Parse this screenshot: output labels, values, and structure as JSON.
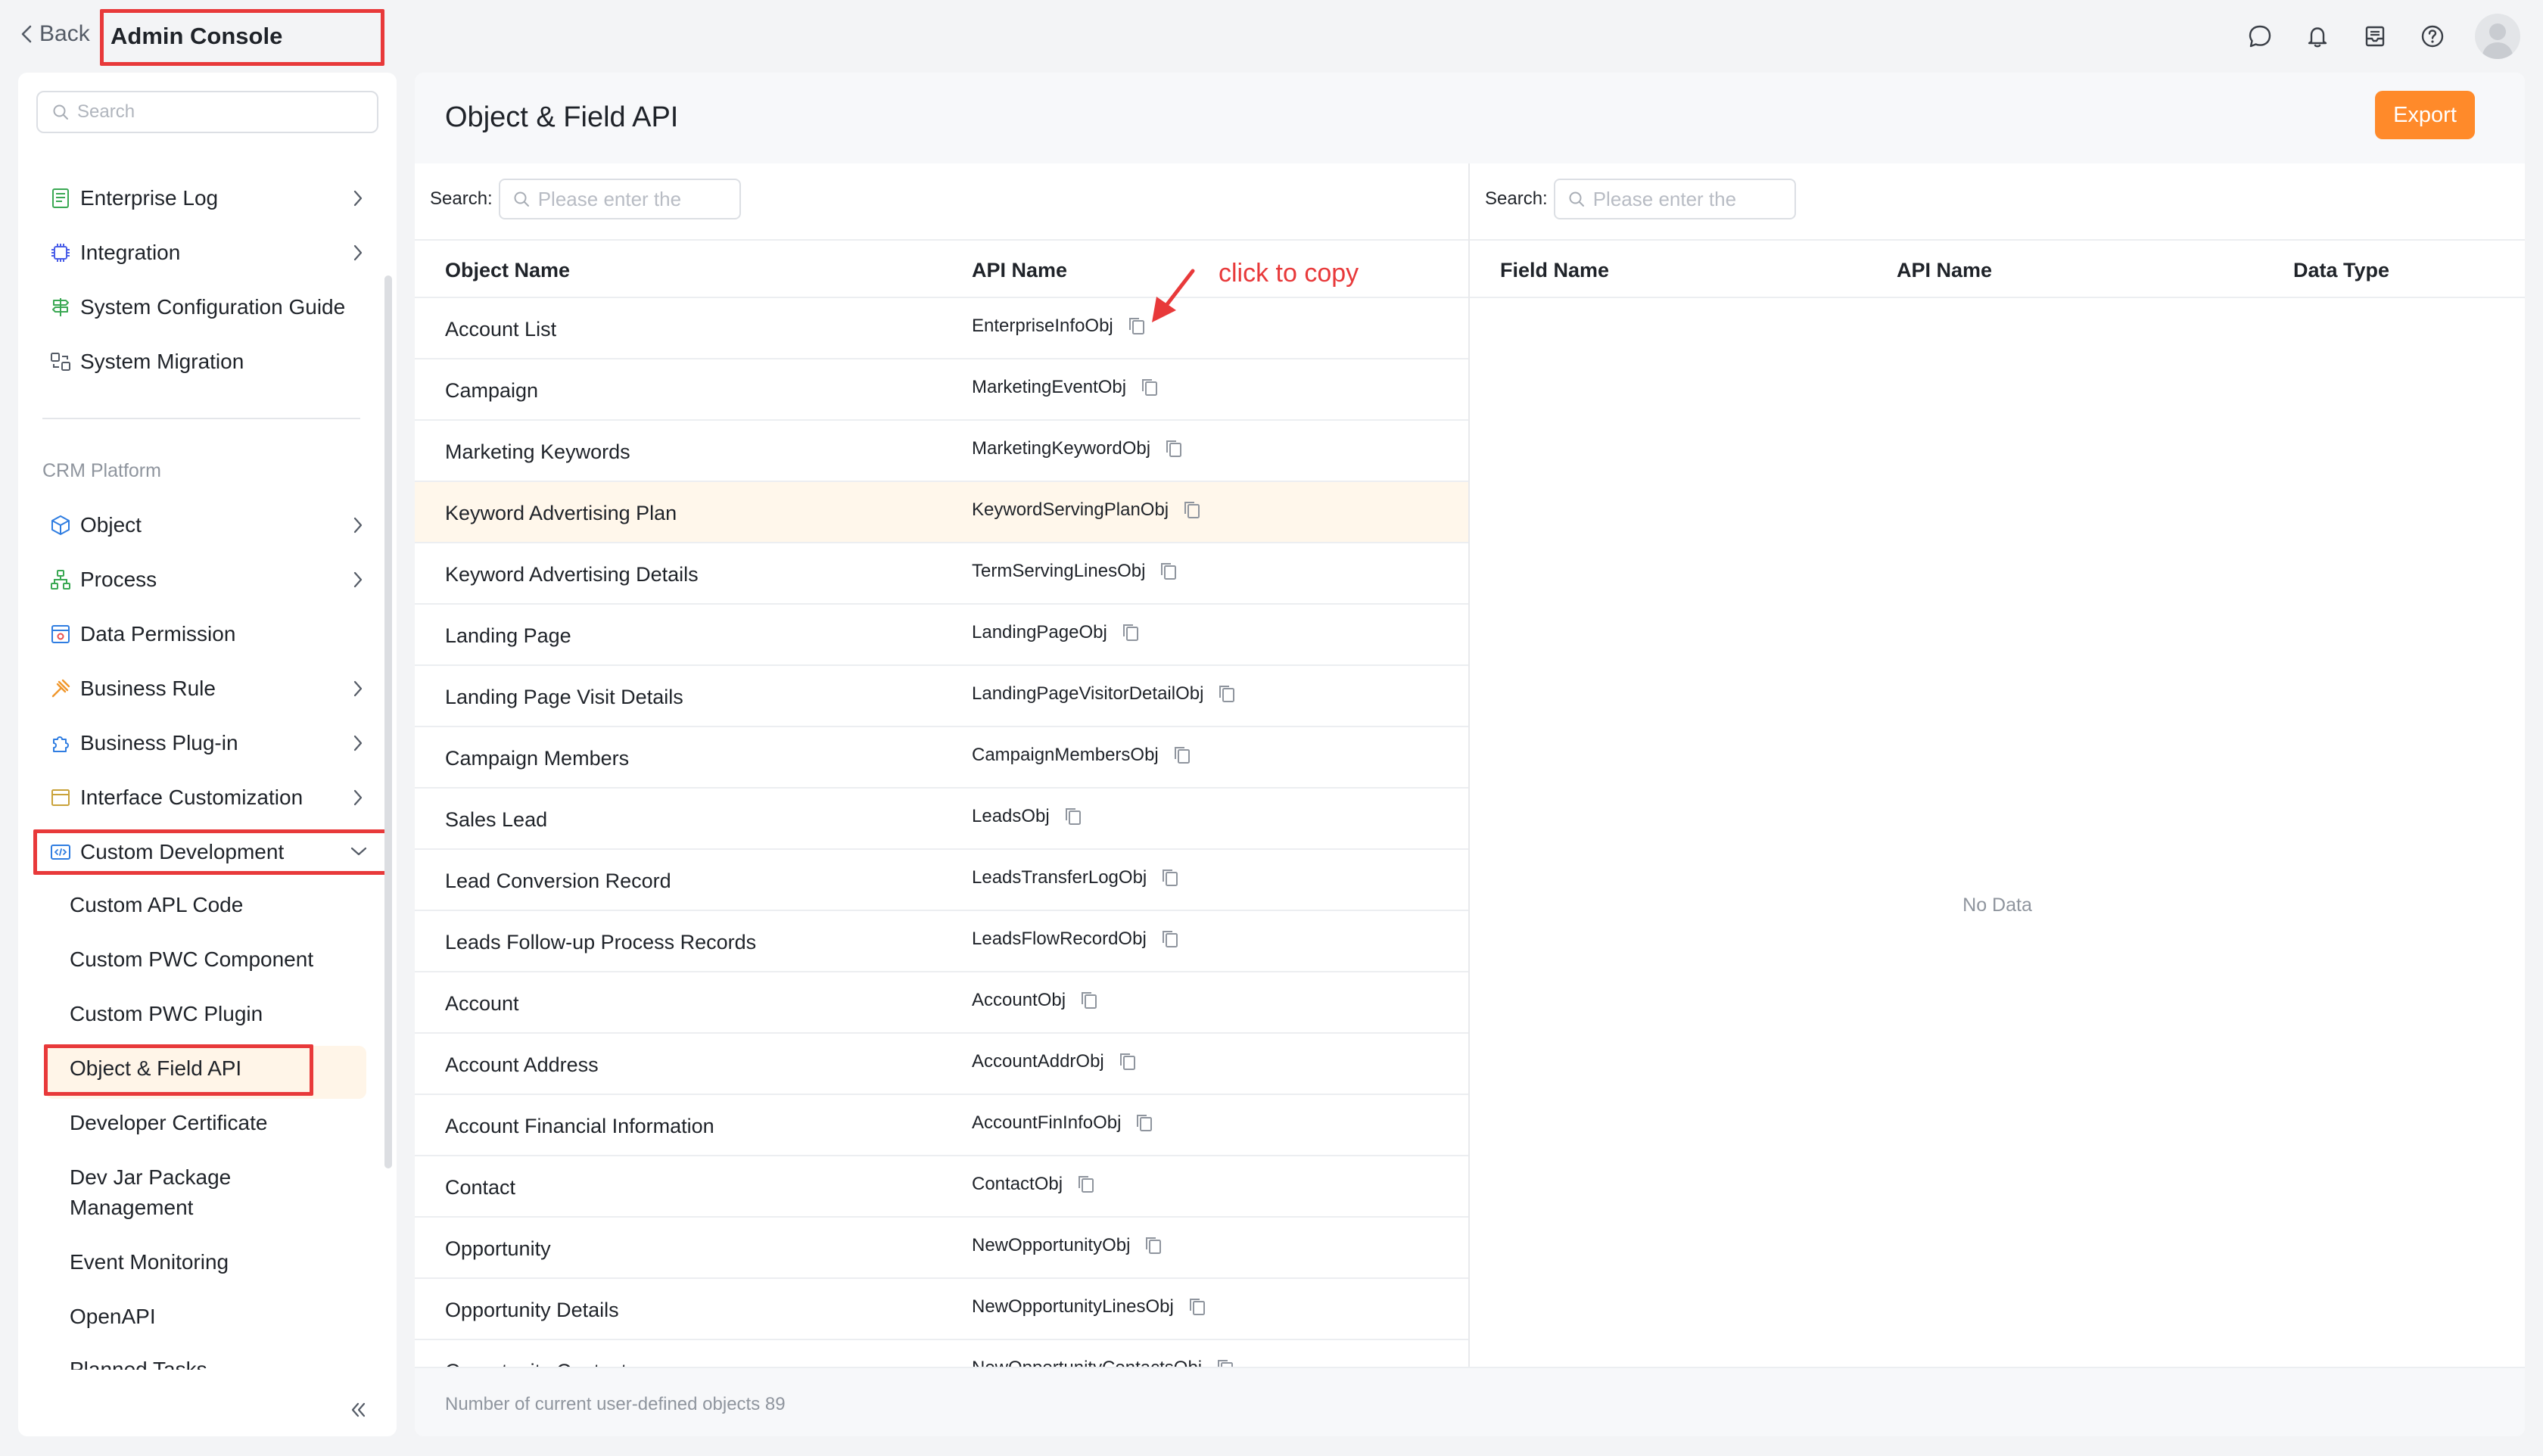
{
  "header": {
    "back_label": "Back",
    "app_title": "Admin Console"
  },
  "sidebar": {
    "search_placeholder": "Search",
    "items": [
      {
        "label": "Enterprise Log",
        "icon": "log-icon",
        "has_chevron": true
      },
      {
        "label": "Integration",
        "icon": "chip-icon",
        "has_chevron": true
      },
      {
        "label": "System Configuration Guide",
        "icon": "guide-icon",
        "has_chevron": false
      },
      {
        "label": "System Migration",
        "icon": "migration-icon",
        "has_chevron": false
      }
    ],
    "section_label": "CRM Platform",
    "crm_items": [
      {
        "label": "Object",
        "icon": "object-icon",
        "has_chevron": true
      },
      {
        "label": "Process",
        "icon": "process-icon",
        "has_chevron": true
      },
      {
        "label": "Data Permission",
        "icon": "permission-icon",
        "has_chevron": false
      },
      {
        "label": "Business Rule",
        "icon": "rule-icon",
        "has_chevron": true
      },
      {
        "label": "Business Plug-in",
        "icon": "plugin-icon",
        "has_chevron": true
      },
      {
        "label": "Interface Customization",
        "icon": "interface-icon",
        "has_chevron": true
      },
      {
        "label": "Custom Development",
        "icon": "code-icon",
        "has_chevron": true,
        "expanded": true
      }
    ],
    "sub_items": [
      "Custom APL Code",
      "Custom PWC Component",
      "Custom PWC Plugin",
      "Object & Field API",
      "Developer Certificate",
      "Dev Jar Package Management",
      "Event Monitoring",
      "OpenAPI",
      "Planned Tasks"
    ],
    "active_sub": "Object & Field API"
  },
  "main": {
    "title": "Object & Field API",
    "export_label": "Export",
    "left_panel": {
      "search_label": "Search:",
      "search_placeholder": "Please enter the",
      "columns": [
        "Object Name",
        "API Name"
      ],
      "rows": [
        {
          "name": "Account List",
          "api": "EnterpriseInfoObj"
        },
        {
          "name": "Campaign",
          "api": "MarketingEventObj"
        },
        {
          "name": "Marketing Keywords",
          "api": "MarketingKeywordObj"
        },
        {
          "name": "Keyword Advertising Plan",
          "api": "KeywordServingPlanObj"
        },
        {
          "name": "Keyword Advertising Details",
          "api": "TermServingLinesObj"
        },
        {
          "name": "Landing Page",
          "api": "LandingPageObj"
        },
        {
          "name": "Landing Page Visit Details",
          "api": "LandingPageVisitorDetailObj"
        },
        {
          "name": "Campaign Members",
          "api": "CampaignMembersObj"
        },
        {
          "name": "Sales Lead",
          "api": "LeadsObj"
        },
        {
          "name": "Lead Conversion Record",
          "api": "LeadsTransferLogObj"
        },
        {
          "name": "Leads Follow-up Process Records",
          "api": "LeadsFlowRecordObj"
        },
        {
          "name": "Account",
          "api": "AccountObj"
        },
        {
          "name": "Account Address",
          "api": "AccountAddrObj"
        },
        {
          "name": "Account Financial Information",
          "api": "AccountFinInfoObj"
        },
        {
          "name": "Contact",
          "api": "ContactObj"
        },
        {
          "name": "Opportunity",
          "api": "NewOpportunityObj"
        },
        {
          "name": "Opportunity Details",
          "api": "NewOpportunityLinesObj"
        },
        {
          "name": "Opportunity Contact",
          "api": "NewOpportunityContactsObj"
        }
      ],
      "hovered_row": 3
    },
    "right_panel": {
      "search_label": "Search:",
      "search_placeholder": "Please enter the",
      "columns": [
        "Field Name",
        "API Name",
        "Data Type"
      ],
      "empty_text": "No Data"
    },
    "annotation": "click to copy",
    "footer_text": "Number of current user-defined objects 89"
  },
  "colors": {
    "accent": "#ff8a2a",
    "highlight_border": "#e8393a",
    "active_bg": "#fff5e8"
  }
}
